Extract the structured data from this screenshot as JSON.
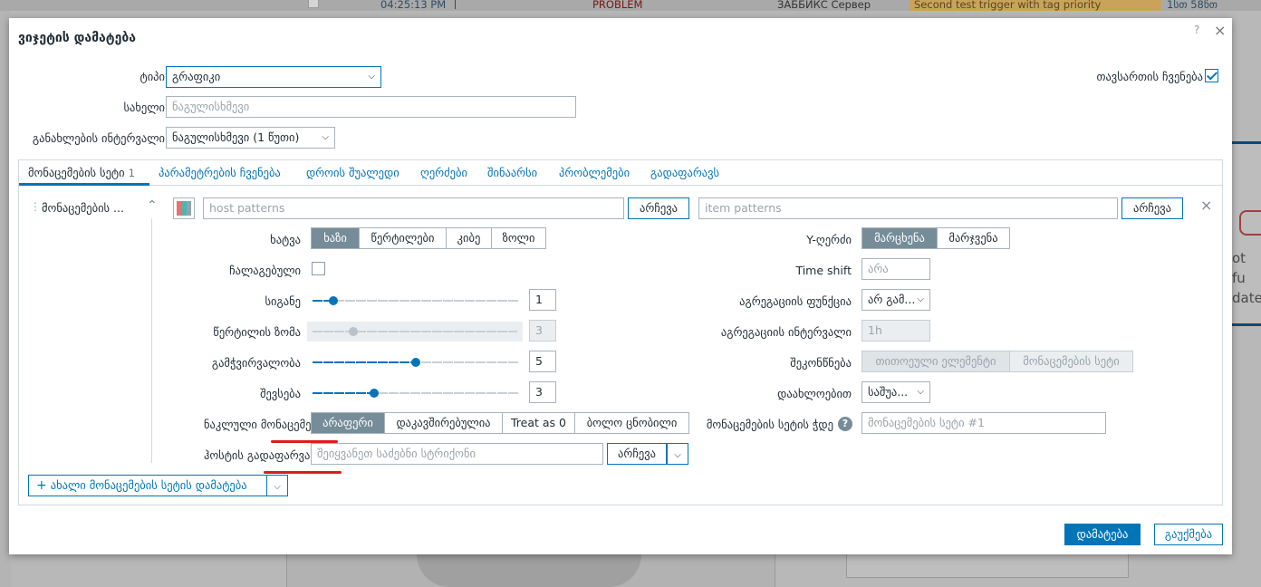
{
  "background": {
    "time": "04:25:13 PM",
    "status": "PROBLEM",
    "host": "ЗАББИКС Сервер",
    "trigger": "Second test trigger with tag priority",
    "duration": "1სთ 58წთ",
    "right_text_1": "ot fu",
    "right_text_2": "date"
  },
  "dialog": {
    "title": "ვიჯეტის დამატება",
    "help": "?",
    "close": "×",
    "type_label": "ტიპი",
    "type_value": "გრაფიკი",
    "show_header_label": "თავსართის ჩვენება",
    "name_label": "სახელი",
    "name_placeholder": "ნაგულისხმევი",
    "refresh_label": "განახლების ინტერვალი",
    "refresh_value": "ნაგულისხმევი (1 წუთი)",
    "add_label": "დამატება",
    "cancel_label": "გაუქმება"
  },
  "tabs": [
    {
      "label": "მონაცემების სეტი",
      "count": "1"
    },
    {
      "label": "პარამეტრების ჩვენება"
    },
    {
      "label": "დროის შუალედი"
    },
    {
      "label": "ღერძები"
    },
    {
      "label": "შინაარსი"
    },
    {
      "label": "პრობლემები"
    },
    {
      "label": "გადაფარავს"
    }
  ],
  "dataset": {
    "name": "მონაცემების ...",
    "host_placeholder": "host patterns",
    "item_placeholder": "item patterns",
    "select_label": "არჩევა",
    "remove": "×",
    "color_a": "#e57373",
    "color_b": "#4db6ac",
    "draw_label": "ხატვა",
    "draw_options": [
      "ხაზი",
      "წერტილები",
      "კიბე",
      "ზოლი"
    ],
    "stacked_label": "ჩალაგებული",
    "width_label": "სიგანე",
    "width_value": "1",
    "width_fraction": 0.1,
    "point_size_label": "წერტილის ზომა",
    "point_size_value": "3",
    "point_size_fraction": 0.2,
    "transparency_label": "გამჭვირვალობა",
    "transparency_value": "5",
    "transparency_fraction": 0.5,
    "fill_label": "შევსება",
    "fill_value": "3",
    "fill_fraction": 0.3,
    "missing_label": "ნაკლული მონაცემები",
    "missing_options": [
      "არაფერი",
      "დაკავშირებულია",
      "Treat as 0",
      "ბოლო ცნობილი"
    ],
    "host_override_label": "ჰოსტის გადაფარვა",
    "host_override_placeholder": "შეიყვანეთ საძებნი სტრიქონი",
    "y_axis_label": "Y-ღერძი",
    "y_axis_options": [
      "მარცხენა",
      "მარჯვენა"
    ],
    "time_shift_label": "Time shift",
    "time_shift_placeholder": "არა",
    "agg_func_label": "აგრეგაციის ფუნქცია",
    "agg_func_value": "არ გამ...",
    "agg_interval_label": "აგრეგაციის ინტერვალი",
    "agg_interval_value": "1h",
    "aggregate_label": "შეკონწნება",
    "aggregate_options": [
      "თითოეული ელემენტი",
      "მონაცემების სეტი"
    ],
    "approx_label": "დაახლოებით",
    "approx_value": "საშუა...",
    "dataset_label_label": "მონაცემების სეტის ჭდე",
    "dataset_label_placeholder": "მონაცემების სეტი #1",
    "add_dataset_label": "ახალი მონაცემების სეტის დამატება"
  }
}
